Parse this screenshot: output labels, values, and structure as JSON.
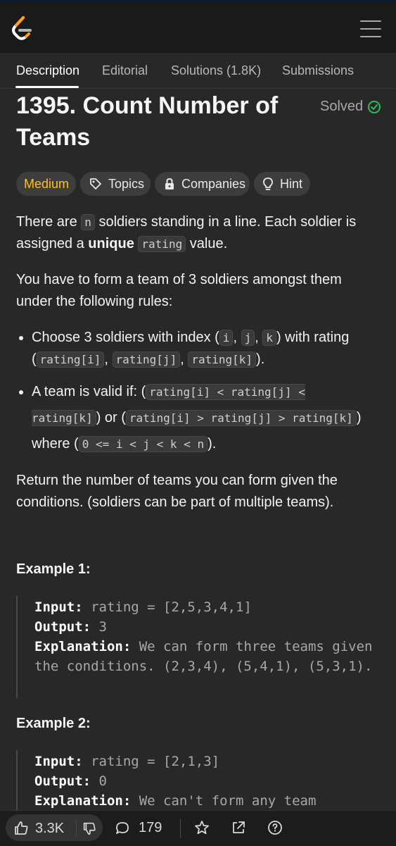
{
  "tabs": {
    "description": "Description",
    "editorial": "Editorial",
    "solutions": "Solutions (1.8K)",
    "submissions": "Submissions"
  },
  "problem": {
    "title": "1395. Count Number of Teams",
    "status": "Solved"
  },
  "chips": {
    "difficulty": "Medium",
    "topics": "Topics",
    "companies": "Companies",
    "hint": "Hint"
  },
  "description": {
    "p1_a": "There are ",
    "p1_code_n": "n",
    "p1_b": " soldiers standing in a line. Each soldier is assigned a ",
    "p1_bold": "unique",
    "p1_code_rating": "rating",
    "p1_c": " value.",
    "p2": "You have to form a team of 3 soldiers amongst them under the following rules:",
    "li1_a": "Choose 3 soldiers with index (",
    "li1_i": "i",
    "li1_j": "j",
    "li1_k": "k",
    "li1_b": ") with rating (",
    "li1_ri": "rating[i]",
    "li1_rj": "rating[j]",
    "li1_rk": "rating[k]",
    "li1_c": ").",
    "li2_a": "A team is valid if: (",
    "li2_c1": "rating[i] < rating[j] < rating[k]",
    "li2_b": ") or (",
    "li2_c2": "rating[i] > rating[j] > rating[k]",
    "li2_c": ") where (",
    "li2_c3": "0 <= i < j < k < n",
    "li2_d": ").",
    "p3": "Return the number of teams you can form given the conditions. (soldiers can be part of multiple teams)."
  },
  "examples": [
    {
      "title": "Example 1:",
      "input_label": "Input:",
      "input": "rating = [2,5,3,4,1]",
      "output_label": "Output:",
      "output": "3",
      "explanation_label": "Explanation:",
      "explanation": "We can form three teams given the conditions. (2,3,4), (5,4,1), (5,3,1)."
    },
    {
      "title": "Example 2:",
      "input_label": "Input:",
      "input": "rating = [2,1,3]",
      "output_label": "Output:",
      "output": "0",
      "explanation_label": "Explanation:",
      "explanation": "We can't form any team"
    }
  ],
  "bottom_bar": {
    "likes": "3.3K",
    "comments": "179"
  },
  "colors": {
    "accent_medium": "#ffc01e",
    "solved_check": "#2cbb5d",
    "background": "#282828",
    "topbar": "#1a1a1a"
  }
}
